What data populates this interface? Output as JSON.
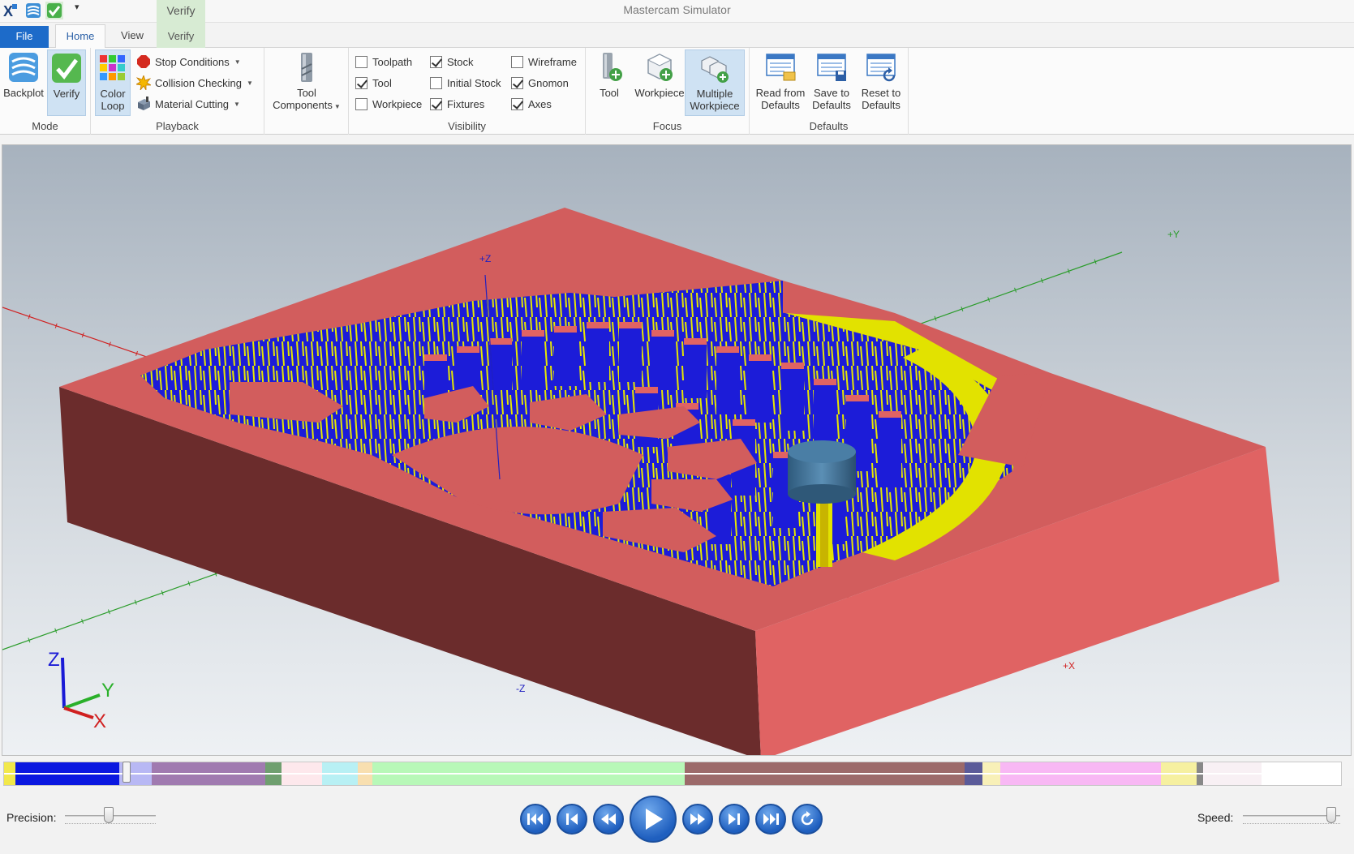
{
  "titlebar": {
    "window_title": "Mastercam Simulator",
    "context_tab": "Verify",
    "quick_access": [
      "app-icon",
      "backplot-icon",
      "verify-icon",
      "customize-dropdown"
    ]
  },
  "tabs": [
    {
      "label": "File"
    },
    {
      "label": "Home",
      "active": true
    },
    {
      "label": "View"
    },
    {
      "label": "Verify"
    }
  ],
  "ribbon": {
    "mode": {
      "label": "Mode",
      "backplot": "Backplot",
      "verify": "Verify"
    },
    "playback": {
      "label": "Playback",
      "color_loop": "Color Loop",
      "stop_conditions": "Stop Conditions",
      "collision_checking": "Collision Checking",
      "material_cutting": "Material Cutting"
    },
    "tool_components": "Tool Components",
    "visibility": {
      "label": "Visibility",
      "toolpath": {
        "label": "Toolpath",
        "checked": false
      },
      "tool": {
        "label": "Tool",
        "checked": true
      },
      "workpiece": {
        "label": "Workpiece",
        "checked": false
      },
      "stock": {
        "label": "Stock",
        "checked": true
      },
      "initial_stock": {
        "label": "Initial Stock",
        "checked": false
      },
      "fixtures": {
        "label": "Fixtures",
        "checked": true
      },
      "wireframe": {
        "label": "Wireframe",
        "checked": false
      },
      "gnomon": {
        "label": "Gnomon",
        "checked": true
      },
      "axes": {
        "label": "Axes",
        "checked": true
      }
    },
    "focus": {
      "label": "Focus",
      "tool": "Tool",
      "workpiece": "Workpiece",
      "multiple_workpiece": "Multiple Workpiece"
    },
    "defaults": {
      "label": "Defaults",
      "read": "Read from Defaults",
      "save": "Save to Defaults",
      "reset": "Reset to Defaults"
    }
  },
  "viewport": {
    "axis_labels": {
      "plus_y": "+Y",
      "plus_z": "+Z",
      "plus_x": "+X",
      "minus_z": "-Z"
    },
    "gnomon": {
      "x": "X",
      "y": "Y",
      "z": "Z"
    },
    "colors": {
      "stock_top": "#e06060",
      "stock_side": "#6b2c2c",
      "cut_blue": "#1a1ad6",
      "cut_yellow": "#e2e200",
      "tool_holder": "#3f6f93",
      "axis_x": "#d02020",
      "axis_y": "#2a9c2a",
      "axis_z": "#2020c0"
    }
  },
  "timeline": {
    "progress": 0.092,
    "segments": [
      "#f2e84a",
      "#0b18e0",
      "#b8b8f4",
      "#a07ab0",
      "#6f9f6f",
      "#fde8ec",
      "#b8f0f4",
      "#f8dfb0",
      "#b8f8b8",
      "#9c6a6a",
      "#5b5b99",
      "#f8f0b8",
      "#f8b8f4",
      "#f6f0a0",
      "#888888",
      "#f8f0f4"
    ]
  },
  "playbar": {
    "precision_label": "Precision:",
    "speed_label": "Speed:",
    "precision_value": 0.48,
    "speed_value": 0.95,
    "buttons": [
      "skip-to-start",
      "step-back",
      "rewind",
      "play",
      "fast-forward",
      "step-forward",
      "skip-to-end",
      "loop"
    ]
  }
}
